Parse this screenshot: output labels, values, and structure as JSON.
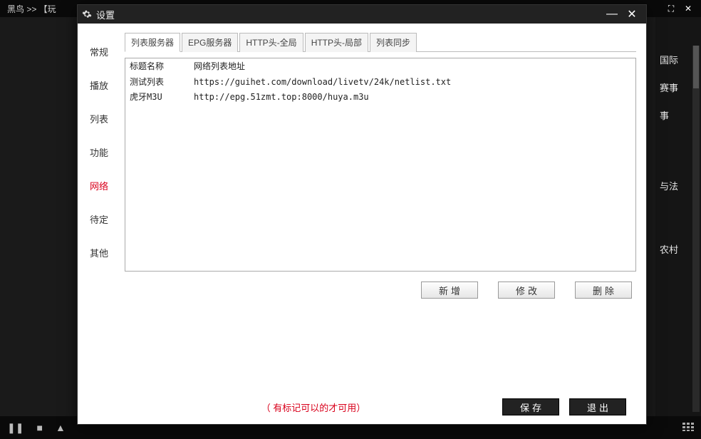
{
  "bg_app": {
    "title": "黑鸟   >>  【玩",
    "right_items": [
      "国际",
      "赛事",
      "事",
      "与法",
      "农村"
    ]
  },
  "dialog": {
    "title": "设置",
    "nav": [
      {
        "label": "常规"
      },
      {
        "label": "播放"
      },
      {
        "label": "列表"
      },
      {
        "label": "功能"
      },
      {
        "label": "网络",
        "active": true
      },
      {
        "label": "待定"
      },
      {
        "label": "其他"
      }
    ],
    "tabs": [
      {
        "label": "列表服务器",
        "active": true
      },
      {
        "label": "EPG服务器"
      },
      {
        "label": "HTTP头-全局"
      },
      {
        "label": "HTTP头-局部"
      },
      {
        "label": "列表同步"
      }
    ],
    "table": {
      "headers": [
        "标题名称",
        "网络列表地址"
      ],
      "rows": [
        {
          "name": "测试列表",
          "url": "https://guihet.com/download/livetv/24k/netlist.txt"
        },
        {
          "name": "虎牙M3U",
          "url": "http://epg.51zmt.top:8000/huya.m3u"
        }
      ]
    },
    "action_buttons": {
      "add": "新增",
      "edit": "修改",
      "del": "删除"
    },
    "footer": {
      "note": "（ 有标记可以的才可用）",
      "save": "保存",
      "exit": "退出"
    }
  }
}
